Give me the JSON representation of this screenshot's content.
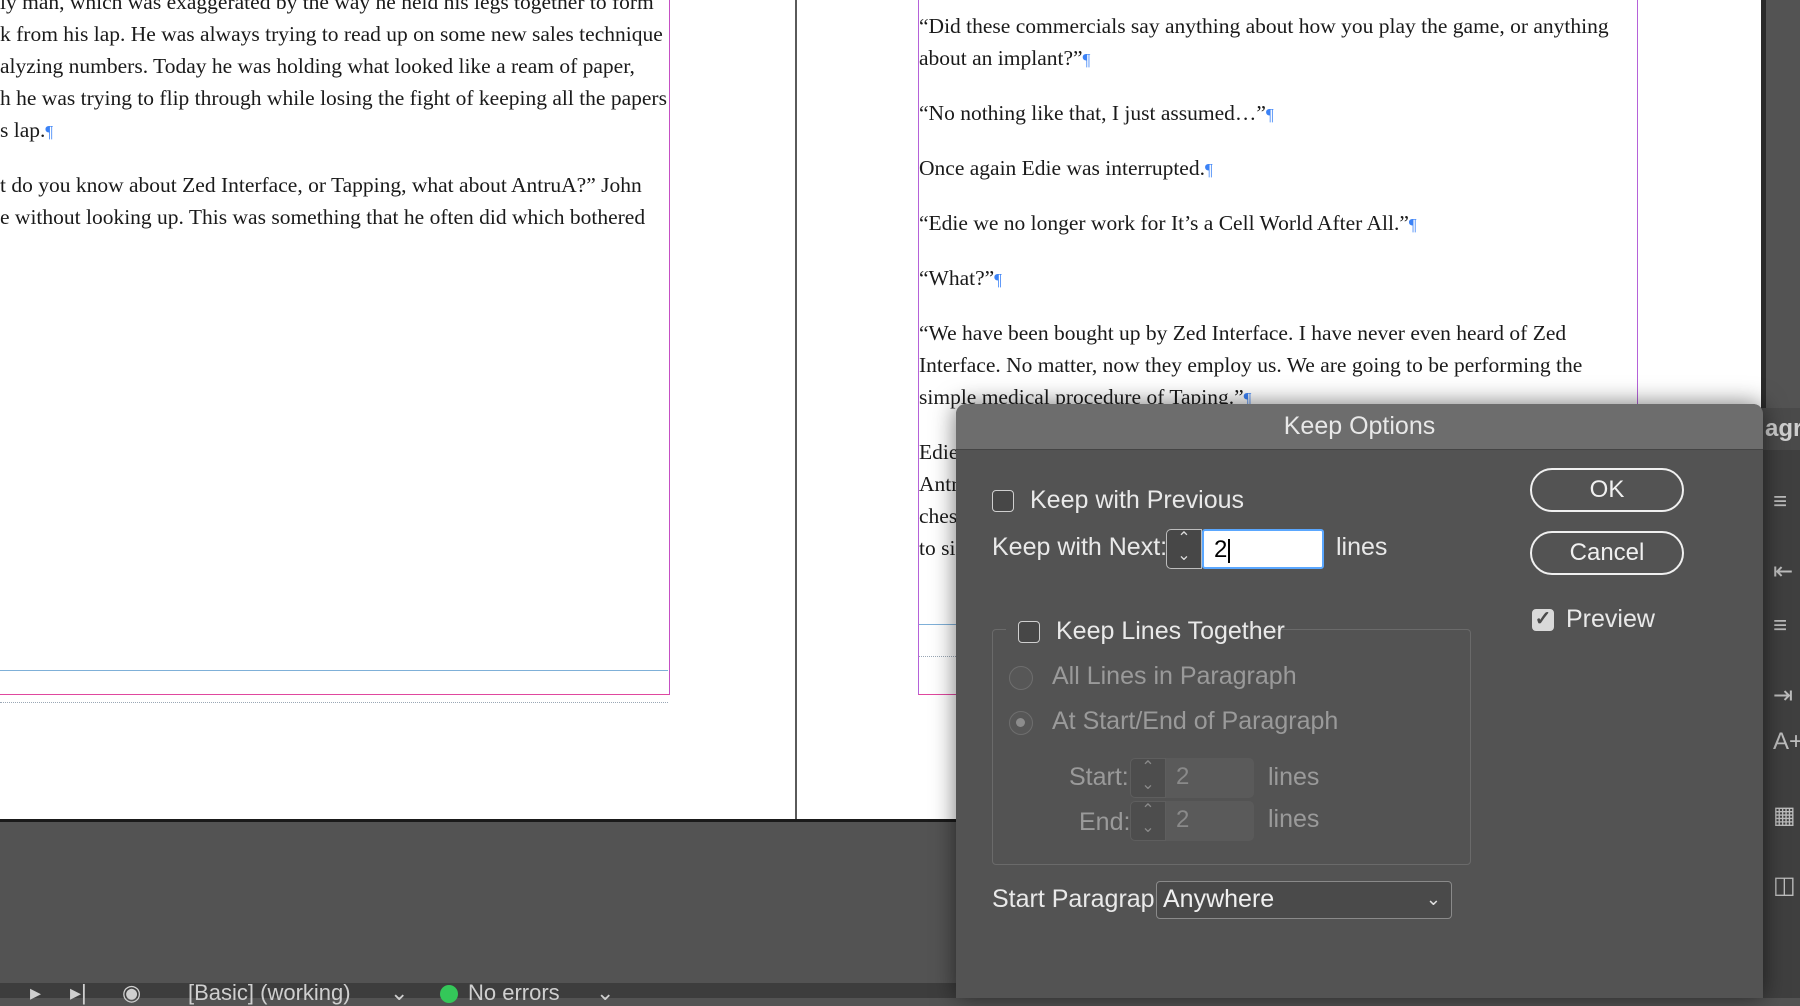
{
  "document": {
    "left_page_lines": [
      "ly man, which was exaggerated by the way he held his legs together to form",
      "k from his lap. He was always trying to read up on some new sales technique",
      "alyzing numbers. Today he was holding what looked like a ream of paper,",
      "h he was trying to flip through while losing the fight of keeping all the papers",
      "s lap.",
      "t do you know about Zed Interface, or Tapping, what about AntruA?” John",
      "e without looking up. This was something that he often did which bothered"
    ],
    "right_page_lines": [
      "“Did these commercials say anything about how you play the game, or anything",
      "about an implant?”",
      "“No nothing like that, I just assumed…”",
      "Once again Edie was interrupted.",
      "“Edie we no longer work for It’s a Cell World After All.”",
      "“What?”",
      "“We have been bought up by Zed Interface. I have never even heard of Zed",
      "Interface. No matter, now they employ us. We are going to be performing the",
      "simple medical procedure of Taping.”",
      "Edie",
      "Antr",
      "ches",
      "to si"
    ],
    "pilcrow": "¶"
  },
  "statusbar": {
    "style_label": "[Basic] (working)",
    "preflight_label": "No errors"
  },
  "panel": {
    "tab_label": "agra"
  },
  "dialog": {
    "title": "Keep Options",
    "keep_with_previous": {
      "label": "Keep with Previous",
      "checked": false
    },
    "keep_with_next": {
      "label": "Keep with Next:",
      "value": "2",
      "unit": "lines"
    },
    "keep_lines_together": {
      "label": "Keep Lines Together",
      "checked": false
    },
    "all_lines": {
      "label": "All Lines in Paragraph"
    },
    "start_end": {
      "label": "At Start/End of Paragraph"
    },
    "start": {
      "label": "Start:",
      "value": "2",
      "unit": "lines"
    },
    "end": {
      "label": "End:",
      "value": "2",
      "unit": "lines"
    },
    "start_paragraph": {
      "label": "Start Paragraph:",
      "value": "Anywhere"
    },
    "ok_label": "OK",
    "cancel_label": "Cancel",
    "preview": {
      "label": "Preview",
      "checked": true
    }
  }
}
